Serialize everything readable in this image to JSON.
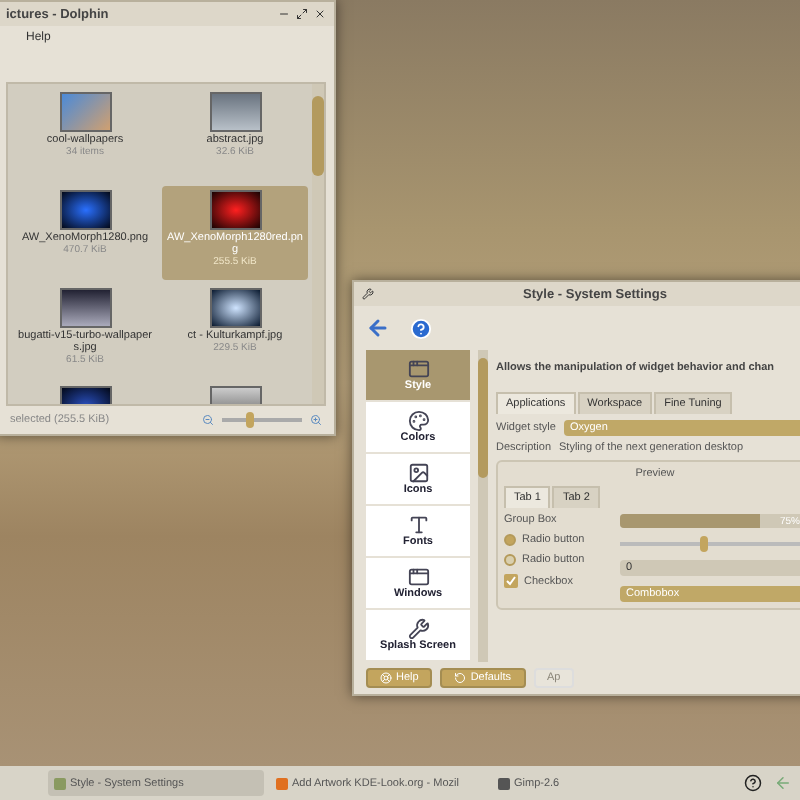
{
  "file_manager": {
    "title": "ictures - Dolphin",
    "menu": [
      "Help"
    ],
    "items": [
      {
        "name": "cool-wallpapers",
        "info": "34 items",
        "kind": "folder",
        "selected": false
      },
      {
        "name": "abstract.jpg",
        "info": "32.6 KiB",
        "kind": "grey",
        "selected": false
      },
      {
        "name": "AW_XenoMorph1280.png",
        "info": "470.7 KiB",
        "kind": "blue",
        "selected": false
      },
      {
        "name": "AW_XenoMorph1280red.png",
        "info": "255.5 KiB",
        "kind": "red",
        "selected": true
      },
      {
        "name": "bugatti-v15-turbo-wallpapers.jpg",
        "info": "61.5 KiB",
        "kind": "car",
        "selected": false
      },
      {
        "name": "ct - Kulturkampf.jpg",
        "info": "229.5 KiB",
        "kind": "light",
        "selected": false
      }
    ],
    "status": "selected (255.5 KiB)",
    "zoom": {
      "level": 0.35
    }
  },
  "settings": {
    "title": "Style - System Settings",
    "categories": [
      {
        "label": "Style",
        "selected": true
      },
      {
        "label": "Colors",
        "selected": false
      },
      {
        "label": "Icons",
        "selected": false
      },
      {
        "label": "Fonts",
        "selected": false
      },
      {
        "label": "Windows",
        "selected": false
      },
      {
        "label": "Splash Screen",
        "selected": false
      }
    ],
    "header": "Allows the manipulation of widget behavior and chan",
    "tabs": [
      {
        "label": "Applications",
        "selected": true
      },
      {
        "label": "Workspace",
        "selected": false
      },
      {
        "label": "Fine Tuning",
        "selected": false
      }
    ],
    "widget_style_label": "Widget style",
    "widget_style": "Oxygen",
    "description_label": "Description",
    "description": "Styling of the next generation desktop",
    "preview": {
      "title": "Preview",
      "tabs": [
        {
          "label": "Tab 1",
          "selected": true
        },
        {
          "label": "Tab 2",
          "selected": false
        }
      ],
      "group_box": "Group Box",
      "progress": {
        "level": 0.75,
        "text": "75%"
      },
      "radios": [
        {
          "label": "Radio button",
          "selected": true
        },
        {
          "label": "Radio button",
          "selected": false
        }
      ],
      "slider": {
        "level": 0.45
      },
      "spin": "0",
      "checkbox": {
        "label": "Checkbox",
        "checked": true
      },
      "combo": "Combobox"
    },
    "buttons": [
      {
        "label": "Help",
        "disabled": false
      },
      {
        "label": "Defaults",
        "disabled": false
      },
      {
        "label": "Ap",
        "disabled": true
      }
    ]
  },
  "taskbar": {
    "tasks": [
      {
        "label": "Style - System Settings",
        "selected": true
      },
      {
        "label": "Add Artwork KDE-Look.org - Mozil",
        "selected": false
      },
      {
        "label": "Gimp-2.6",
        "selected": false
      }
    ]
  }
}
